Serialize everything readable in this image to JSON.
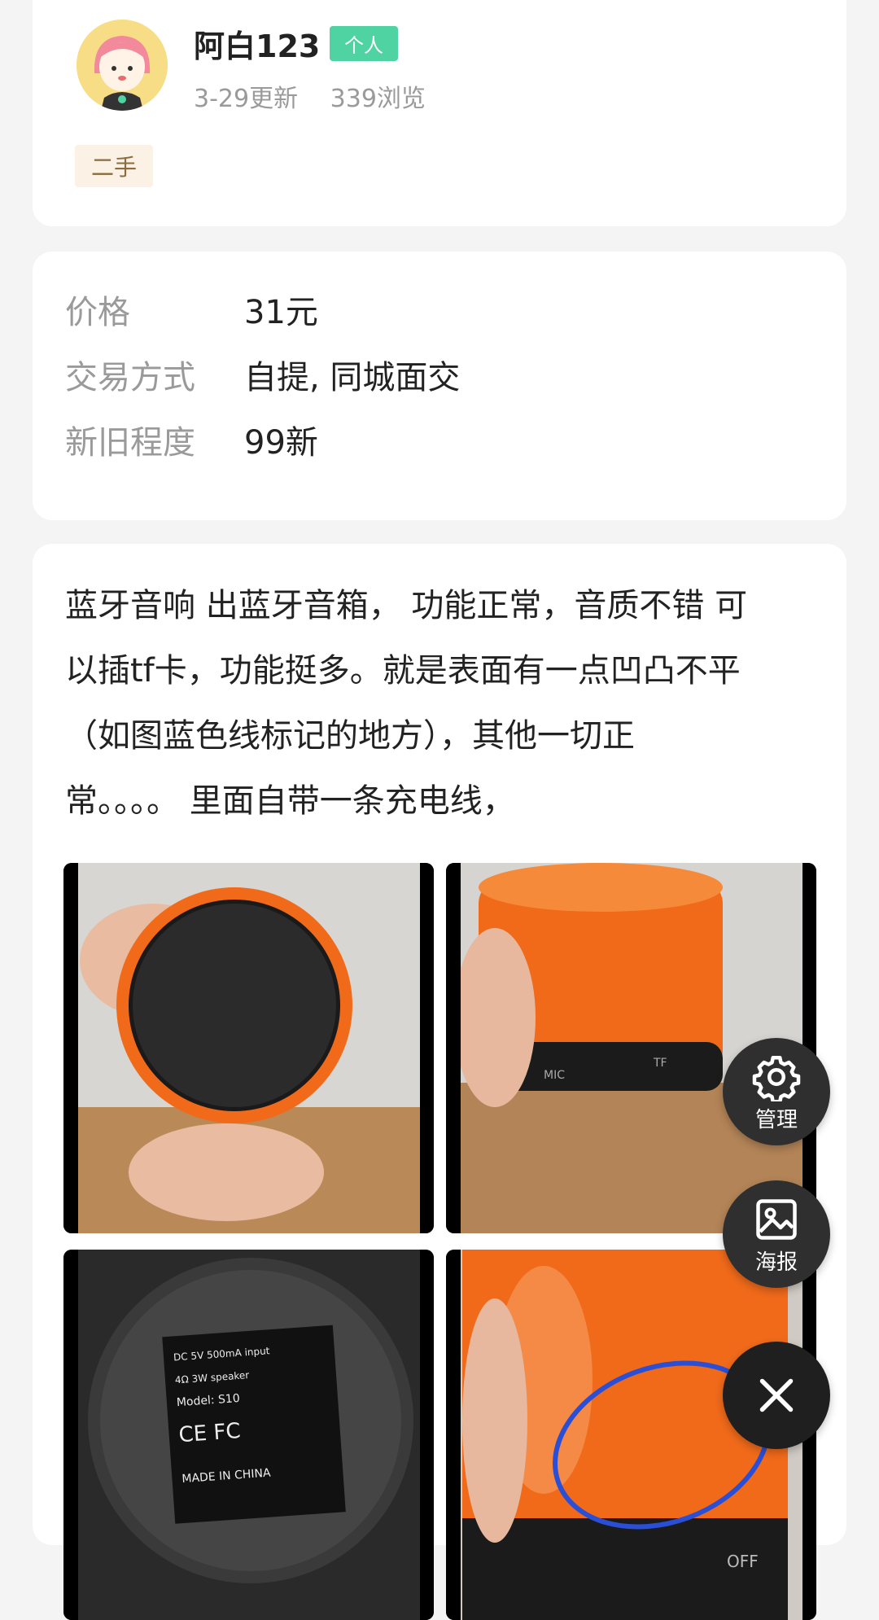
{
  "user": {
    "name": "阿白123",
    "badge": "个人",
    "updated": "3-29更新",
    "views": "339浏览",
    "tag": "二手"
  },
  "details": [
    {
      "key": "价格",
      "value": "31元"
    },
    {
      "key": "交易方式",
      "value": "自提, 同城面交"
    },
    {
      "key": "新旧程度",
      "value": "99新"
    }
  ],
  "description": {
    "lines": [
      "蓝牙音响 出蓝牙音箱， 功能正常，音质不错 可",
      "以插tf卡，功能挺多。就是表面有一点凹凸不平",
      "（如图蓝色线标记的地方），其他一切正",
      "常。。。。 里面自带一条充电线，"
    ]
  },
  "photos": {
    "count": 4,
    "label_text": {
      "p2_mic": "MIC",
      "p2_tf": "TF",
      "p3_lines": [
        "DC 5V 500mA input",
        "4Ω 3W speaker",
        "Model: S10",
        "CE FC",
        "MADE IN CHINA"
      ],
      "p4_off": "OFF"
    }
  },
  "fabs": {
    "manage": {
      "label": "管理",
      "icon": "gear-icon"
    },
    "poster": {
      "label": "海报",
      "icon": "image-icon"
    },
    "close": {
      "icon": "close-icon"
    }
  },
  "colors": {
    "badge": "#4fd3a2",
    "speaker_orange": "#f06a1a",
    "fab_bg": "#2f2f2f"
  }
}
